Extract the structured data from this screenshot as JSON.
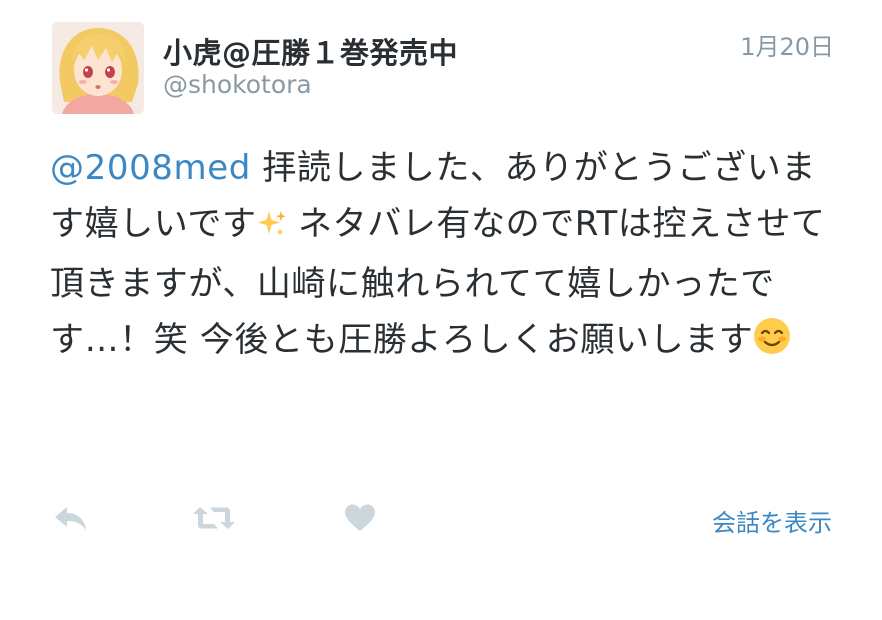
{
  "user": {
    "display_name": "小虎@圧勝１巻発売中",
    "screen_name": "@shokotora"
  },
  "timestamp": "1月20日",
  "tweet": {
    "mention": "@2008med",
    "text_part1": " 拝読しました、ありがとうございます嬉しいです",
    "emoji1": "sparkles",
    "text_part2": " ネタバレ有なのでRTは控えさせて頂きますが、山崎に触れられてて嬉しかったです…！笑 今後とも圧勝よろしくお願いします",
    "emoji2": "smiling-face"
  },
  "actions": {
    "reply_icon": "reply-icon",
    "retweet_icon": "retweet-icon",
    "like_icon": "heart-icon",
    "view_conversation": "会話を表示"
  },
  "colors": {
    "link": "#3b88c3",
    "muted": "#8899a6",
    "text": "#292f33",
    "icon": "#ccd6dd"
  }
}
